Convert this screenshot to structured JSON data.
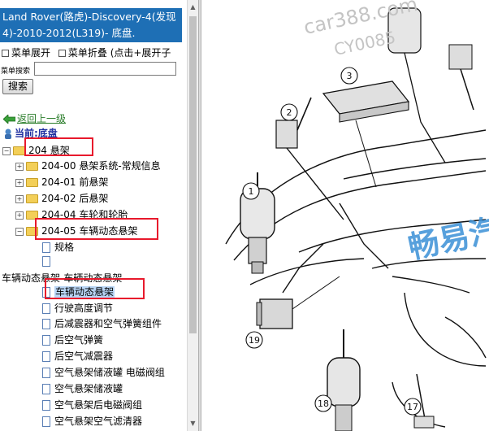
{
  "header": {
    "title": "Land Rover(路虎)-Discovery-4(发现4)-2010-2012(L319)- 底盘."
  },
  "menu": {
    "expand_label": "菜单展开",
    "collapse_label": "菜单折叠",
    "hint": "(点击+展开子"
  },
  "search": {
    "label": "菜单搜索",
    "button": "搜索"
  },
  "nav": {
    "back": "返回上一级",
    "current": "当前:底盘"
  },
  "tree": {
    "root": "204 悬架",
    "sections": [
      "204-00 悬架系统-常规信息",
      "204-01 前悬架",
      "204-02 后悬架",
      "204-04 车轮和轮胎"
    ],
    "expanded": "204-05 车辆动态悬架",
    "sub_items": [
      "规格",
      ""
    ],
    "group_label": "车辆动态悬架-车辆动态悬架",
    "selected": "车辆动态悬架",
    "docs": [
      "行驶高度调节",
      "后减震器和空气弹簧组件",
      "后空气弹簧",
      "后空气减震器",
      "空气悬架储液罐 电磁阀组",
      "空气悬架储液罐",
      "空气悬架后电磁阀组",
      "空气悬架空气滤清器"
    ]
  },
  "diagram": {
    "watermark_top": "car388.com",
    "watermark_top2": "CY0085",
    "watermark_brand": "畅易汽",
    "callouts": [
      "1",
      "2",
      "3",
      "17",
      "18",
      "19"
    ]
  }
}
